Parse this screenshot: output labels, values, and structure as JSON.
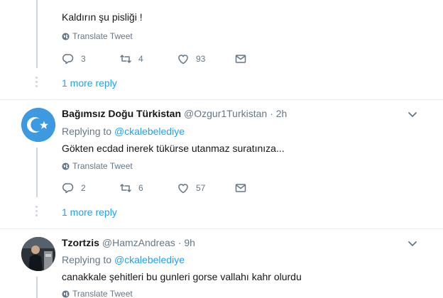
{
  "tweet1": {
    "text": "Kaldırın şu pisliği  !",
    "translate_label": "Translate Tweet",
    "replies": "3",
    "retweets": "4",
    "likes": "93",
    "more_replies": "1 more reply"
  },
  "tweet2": {
    "name": "Bağımsız Doğu Türkistan",
    "handle": "@Ozgur1Turkistan",
    "time": "· 2h",
    "replying_prefix": "Replying to",
    "replying_to": "@ckalebelediye",
    "text": "Gökten ecdad inerek tükürse utanmaz suratınıza...",
    "translate_label": "Translate Tweet",
    "replies": "2",
    "retweets": "6",
    "likes": "57",
    "more_replies": "1 more reply"
  },
  "tweet3": {
    "name": "Tzortzis",
    "handle": "@HamzAndreas",
    "time": "· 9h",
    "replying_prefix": "Replying to",
    "replying_to": "@ckalebelediye",
    "text": "canakkale şehitleri bu gunleri gorse vallahı kahr olurdu",
    "translate_label": "Translate Tweet"
  },
  "colors": {
    "accent": "#1da1f2",
    "muted": "#657786",
    "text": "#14171a",
    "flag_blue": "#3e9ae0"
  },
  "icons": [
    "globe-icon",
    "reply-icon",
    "retweet-icon",
    "like-icon",
    "dm-icon",
    "chevron-down-icon"
  ]
}
